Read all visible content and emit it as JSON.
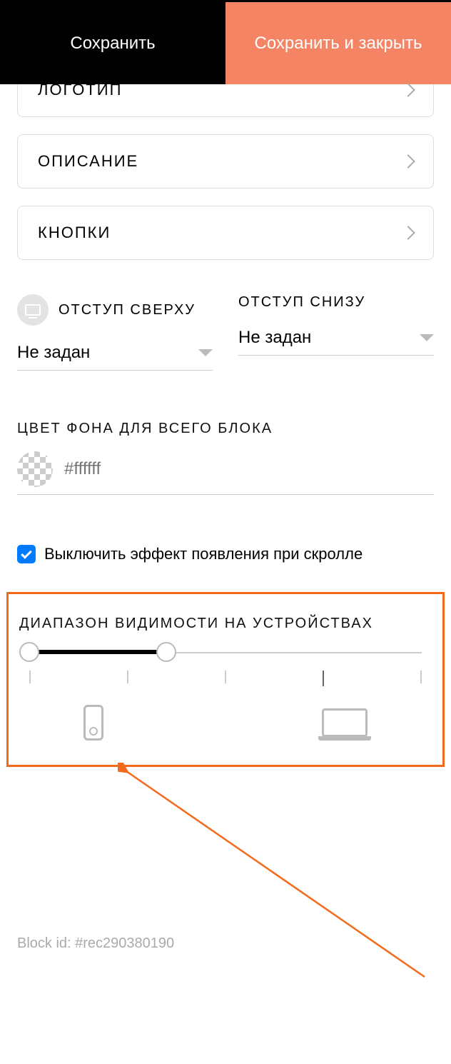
{
  "toolbar": {
    "save": "Сохранить",
    "save_close": "Сохранить и закрыть"
  },
  "accordion": {
    "logo": "ЛОГОТИП",
    "description": "ОПИСАНИЕ",
    "buttons": "КНОПКИ"
  },
  "padding": {
    "top_label": "ОТСТУП СВЕРХУ",
    "bottom_label": "ОТСТУП СНИЗУ",
    "top_value": "Не задан",
    "bottom_value": "Не задан"
  },
  "bgcolor": {
    "label": "ЦВЕТ ФОНА ДЛЯ ВСЕГО БЛОКА",
    "placeholder": "#ffffff"
  },
  "scroll_effect": {
    "label": "Выключить эффект появления при скролле",
    "checked": true
  },
  "visibility": {
    "label": "ДИАПАЗОН ВИДИМОСТИ НА УСТРОЙСТВАХ"
  },
  "block_id": "Block id: #rec290380190"
}
